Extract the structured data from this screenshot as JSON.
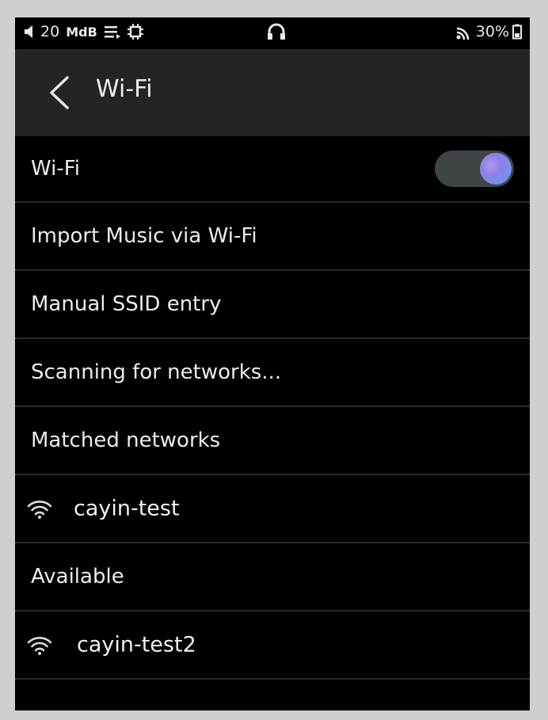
{
  "status_bar": {
    "volume": "20",
    "gain": "MdB",
    "battery": "30%",
    "icons": [
      "volume-icon",
      "queue-icon",
      "chip-icon",
      "headphones-icon",
      "wifi-signal-icon",
      "battery-icon"
    ]
  },
  "header": {
    "title": "Wi-Fi"
  },
  "rows": {
    "wifi_toggle_label": "Wi-Fi",
    "wifi_enabled": true,
    "import_music": "Import Music via Wi-Fi",
    "manual_ssid": "Manual SSID entry",
    "scanning": "Scanning for networks...",
    "matched_header": "Matched networks",
    "matched_network": "cayin-test",
    "available_header": "Available",
    "available_network": "cayin-test2"
  },
  "colors": {
    "background": "#000000",
    "appbar": "#232425",
    "divider": "#2a2a2a",
    "toggle_track": "#3f4446",
    "toggle_knob": "#8e7ee8",
    "text": "#ececec"
  }
}
